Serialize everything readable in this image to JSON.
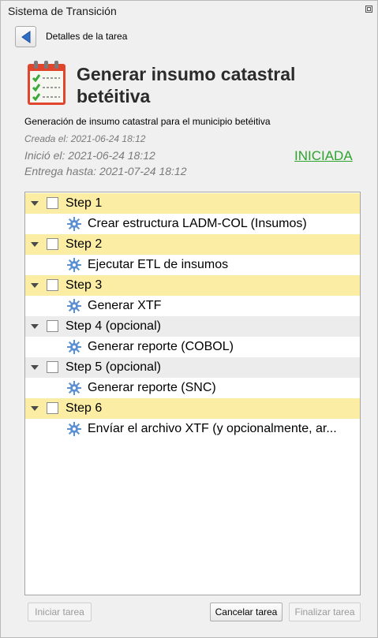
{
  "window": {
    "title": "Sistema de Transición"
  },
  "header": {
    "back_label": "Detalles de la tarea"
  },
  "task": {
    "title": "Generar insumo catastral betéitiva",
    "description": "Generación de insumo catastral para el municipio betéitiva",
    "created": "Creada el: 2021-06-24 18:12",
    "started": "Inició el: 2021-06-24 18:12",
    "due": "Entrega hasta: 2021-07-24 18:12",
    "status": "INICIADA",
    "status_color": "#2ea32e"
  },
  "steps": [
    {
      "label": "Step 1",
      "optional": false,
      "checked": false,
      "sub": "Crear estructura LADM-COL (Insumos)"
    },
    {
      "label": "Step 2",
      "optional": false,
      "checked": false,
      "sub": "Ejecutar ETL de insumos"
    },
    {
      "label": "Step 3",
      "optional": false,
      "checked": false,
      "sub": "Generar XTF"
    },
    {
      "label": "Step 4 (opcional)",
      "optional": true,
      "checked": false,
      "sub": "Generar reporte (COBOL)"
    },
    {
      "label": "Step 5 (opcional)",
      "optional": true,
      "checked": false,
      "sub": "Generar reporte (SNC)"
    },
    {
      "label": "Step 6",
      "optional": false,
      "checked": false,
      "sub": "Envíar el archivo XTF (y opcionalmente, ar..."
    }
  ],
  "buttons": {
    "start": "Iniciar tarea",
    "cancel": "Cancelar tarea",
    "finish": "Finalizar tarea"
  },
  "colors": {
    "required_step_bg": "#fbeea4",
    "optional_step_bg": "#ececec",
    "gear": "#5b8fd6"
  },
  "icons": {
    "back": "left-arrow-icon",
    "task": "calendar-checklist-icon",
    "sub_step": "gear-icon",
    "expand": "chevron-down-icon"
  }
}
